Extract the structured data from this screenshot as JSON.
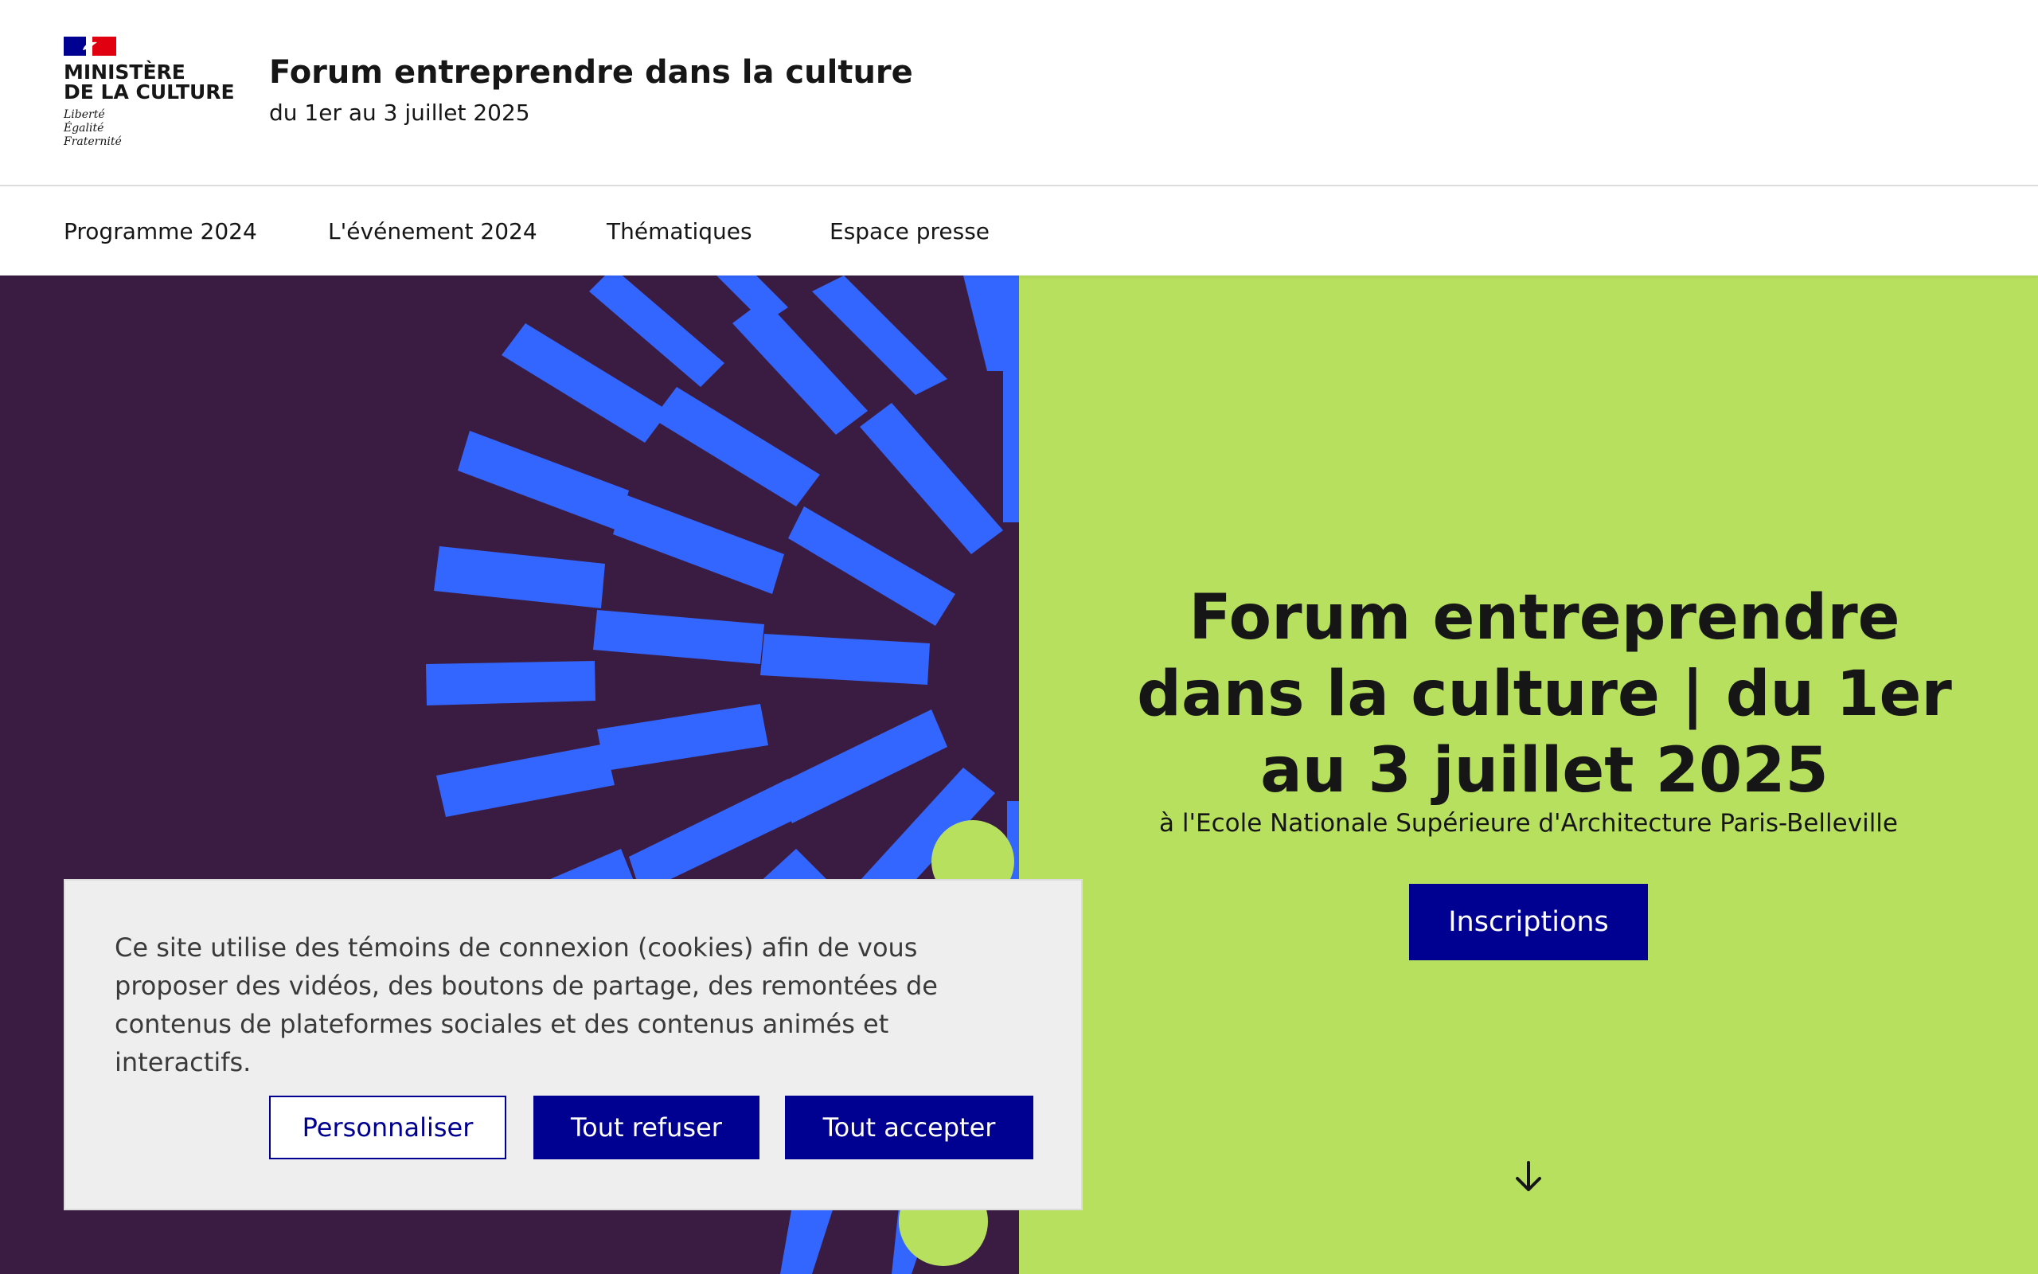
{
  "header": {
    "logo": {
      "line1": "MINISTÈRE",
      "line2": "DE LA CULTURE",
      "motto": [
        "Liberté",
        "Égalité",
        "Fraternité"
      ]
    },
    "title": "Forum entreprendre dans la culture",
    "subtitle": "du 1er au 3 juillet 2025"
  },
  "nav": {
    "items": [
      {
        "label": "Programme 2024"
      },
      {
        "label": "L'événement 2024"
      },
      {
        "label": "Thématiques"
      },
      {
        "label": "Espace presse"
      }
    ]
  },
  "hero": {
    "title_bold": "Forum entreprendre dans la culture |",
    "title_regular": " du 1er au 3 juillet 2025",
    "place": "à l'Ecole Nationale Supérieure d'Architecture Paris-Belleville",
    "cta_label": "Inscriptions",
    "scroll_icon": "arrow-down-icon"
  },
  "cookie_banner": {
    "text": "Ce site utilise des témoins de connexion (cookies) afin de vous proposer des vidéos, des boutons de partage, des remontées de contenus de plateformes sociales et des contenus animés et interactifs.",
    "customize_label": "Personnaliser",
    "refuse_label": "Tout refuser",
    "accept_label": "Tout accepter"
  },
  "colors": {
    "brand_blue": "#000091",
    "hero_green": "#b8e05f",
    "hero_purple": "#3a1c43",
    "ray_blue": "#3366ff",
    "dot_green": "#b8e05f",
    "flag_red": "#e1000f"
  }
}
